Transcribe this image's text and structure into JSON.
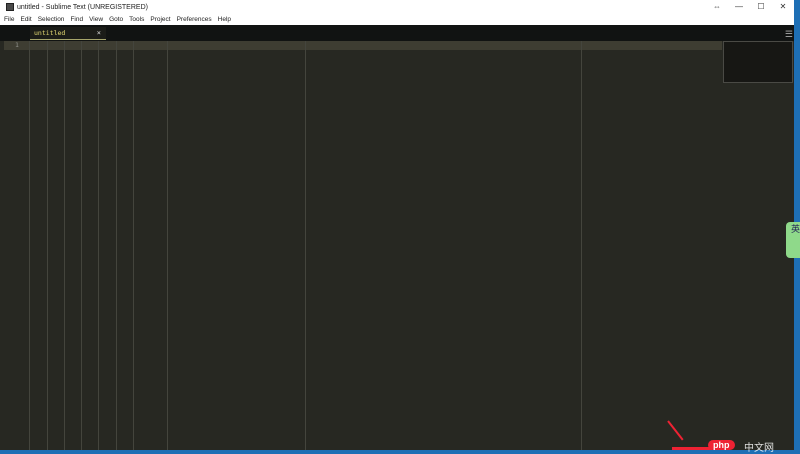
{
  "window": {
    "title": "untitled - Sublime Text (UNREGISTERED)",
    "controls": [
      "⇔",
      "—",
      "☐",
      "✕"
    ]
  },
  "menu": [
    "File",
    "Edit",
    "Selection",
    "Find",
    "View",
    "Goto",
    "Tools",
    "Project",
    "Preferences",
    "Help"
  ],
  "tab": {
    "label": "untitled",
    "close": "×"
  },
  "editor": {
    "line_numbers": [
      "1"
    ]
  },
  "ime": {
    "label": "英"
  },
  "watermark": {
    "php": "php",
    "cn": "中文网"
  },
  "colors": {
    "background": "#272822",
    "tab_text": "#e6db74"
  }
}
